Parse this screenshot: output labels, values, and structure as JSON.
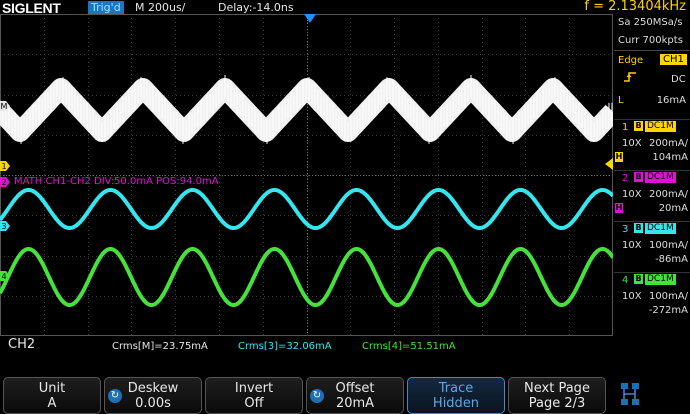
{
  "header": {
    "logo": "SIGLENT",
    "trigger_status": "Trig'd",
    "timebase": "M 200us/",
    "delay": "Delay:-14.0ns",
    "frequency": "f = 2.13404kHz"
  },
  "right_panel": {
    "sample_rate": "Sa 250MSa/s",
    "memory_depth": "Curr 700kpts",
    "trigger": {
      "type": "Edge",
      "source": "CH1",
      "slope_icon": "rising-edge-icon",
      "coupling": "DC",
      "level_prefix": "L",
      "level": "16mA"
    },
    "channels": [
      {
        "num": "1",
        "bw": "B",
        "coupling": "DC1M",
        "probe": "10X",
        "scale": "200mA/",
        "offset": "104mA",
        "color": "#ffd500",
        "bw_limit": "H"
      },
      {
        "num": "2",
        "bw": "B",
        "coupling": "DC1M",
        "probe": "10X",
        "scale": "200mA/",
        "offset": "20mA",
        "color": "#e011d4",
        "bw_limit": "H"
      },
      {
        "num": "3",
        "bw": "B",
        "coupling": "DC1M",
        "probe": "10X",
        "scale": "100mA/",
        "offset": "-86mA",
        "color": "#33e6ef",
        "bw_limit": ""
      },
      {
        "num": "4",
        "bw": "B",
        "coupling": "DC1M",
        "probe": "10X",
        "scale": "100mA/",
        "offset": "-272mA",
        "color": "#44e23a",
        "bw_limit": ""
      }
    ]
  },
  "math_label": "MATH  CH1-CH2  DIV:50.0mA  POS:94.0mA",
  "channel_markers": [
    "M",
    "1",
    "2",
    "3",
    "4"
  ],
  "status_bar": {
    "selected_channel": "CH2",
    "measurements": [
      {
        "text": "Crms[M]=23.75mA",
        "color": "#e6e6e6"
      },
      {
        "text": "Crms[3]=32.06mA",
        "color": "#33e6ef"
      },
      {
        "text": "Crms[4]=51.51mA",
        "color": "#44e23a"
      }
    ]
  },
  "softkeys": [
    {
      "title": "Unit",
      "value": "A",
      "knob": false,
      "active": false
    },
    {
      "title": "Deskew",
      "value": "0.00s",
      "knob": true,
      "active": false
    },
    {
      "title": "Invert",
      "value": "Off",
      "knob": false,
      "active": false
    },
    {
      "title": "Offset",
      "value": "20mA",
      "knob": true,
      "active": false
    },
    {
      "title": "Trace",
      "value": "Hidden",
      "knob": false,
      "active": true
    },
    {
      "title": "Next Page",
      "value": "Page 2/3",
      "knob": false,
      "active": false
    }
  ],
  "colors": {
    "grid": "#3a3a3a",
    "math_trace": "#f2f2f2",
    "math_label": "#e011d4",
    "trigger_marker": "#1e90ff"
  },
  "icons": [
    "knob-icon",
    "rising-edge-icon",
    "network-icon"
  ]
}
